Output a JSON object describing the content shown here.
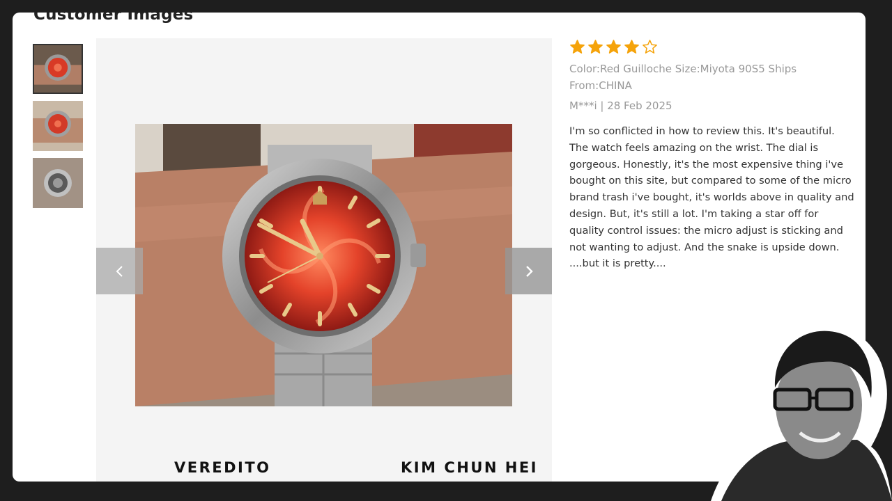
{
  "section": {
    "title": "Customer Images"
  },
  "thumbnails": [
    {
      "label": "watch-on-wrist-red-dial",
      "active": true
    },
    {
      "label": "watch-on-wrist-red-dial-2",
      "active": false
    },
    {
      "label": "watch-caseback",
      "active": false
    }
  ],
  "review": {
    "rating": 4,
    "max_rating": 5,
    "variant": "Color:Red Guilloche Size:Miyota 90S5 Ships From:CHINA",
    "author_date": "M***i | 28 Feb 2025",
    "text": "I'm so conflicted in how to review this. It's beautiful. The watch feels amazing on the wrist. The dial is gorgeous. Honestly, it's the most expensive thing i've bought on this site, but compared to some of the micro brand trash i've bought, it's worlds above in quality and design. But, it's still a lot. I'm taking a star off for quality control issues: the micro adjust is sticking and not wanting to adjust. And the snake is upside down. ....but it is pretty...."
  },
  "captions": {
    "left": "VEREDITO",
    "right": "KIM CHUN HEI"
  },
  "icons": {
    "prev": "chevron-left-icon",
    "next": "chevron-right-icon",
    "star_full": "star-filled-icon",
    "star_empty": "star-outline-icon"
  },
  "colors": {
    "star": "#f5a30a",
    "background": "#1e1e1e",
    "card": "#ffffff",
    "dial": "#d83a26"
  }
}
